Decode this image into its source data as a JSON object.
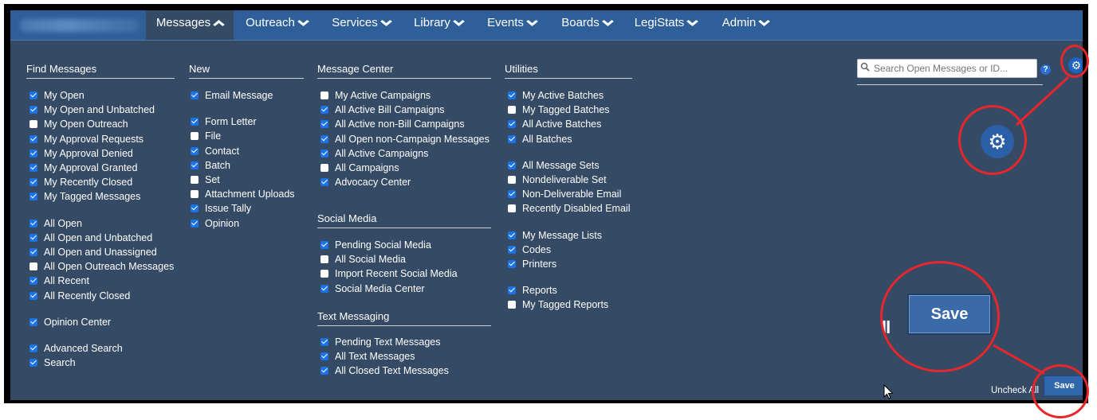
{
  "nav": {
    "items": [
      {
        "label": "Messages",
        "active": true
      },
      {
        "label": "Outreach"
      },
      {
        "label": "Services"
      },
      {
        "label": "Library"
      },
      {
        "label": "Events"
      },
      {
        "label": "Boards"
      },
      {
        "label": "LegiStats"
      },
      {
        "label": "Admin"
      }
    ],
    "active_chevron": "chevron-up-icon",
    "chevron": "chevron-down-icon"
  },
  "columns": {
    "find": {
      "title": "Find Messages",
      "items": [
        {
          "label": "My Open",
          "checked": true
        },
        {
          "label": "My Open and Unbatched",
          "checked": true
        },
        {
          "label": "My Open Outreach",
          "checked": false
        },
        {
          "label": "My Approval Requests",
          "checked": true
        },
        {
          "label": "My Approval Denied",
          "checked": true
        },
        {
          "label": "My Approval Granted",
          "checked": true
        },
        {
          "label": "My Recently Closed",
          "checked": true
        },
        {
          "label": "My Tagged Messages",
          "checked": true
        },
        {
          "label": "All Open",
          "checked": true
        },
        {
          "label": "All Open and Unbatched",
          "checked": true
        },
        {
          "label": "All Open and Unassigned",
          "checked": true
        },
        {
          "label": "All Open Outreach Messages",
          "checked": false
        },
        {
          "label": "All Recent",
          "checked": true
        },
        {
          "label": "All Recently Closed",
          "checked": true
        },
        {
          "label": "Opinion Center",
          "checked": true
        },
        {
          "label": "Advanced Search",
          "checked": true
        },
        {
          "label": "Search",
          "checked": true
        }
      ]
    },
    "new": {
      "title": "New",
      "items": [
        {
          "label": "Email Message",
          "checked": true
        },
        {
          "label": "Form Letter",
          "checked": true
        },
        {
          "label": "File",
          "checked": false
        },
        {
          "label": "Contact",
          "checked": true
        },
        {
          "label": "Batch",
          "checked": true
        },
        {
          "label": "Set",
          "checked": false
        },
        {
          "label": "Attachment Uploads",
          "checked": false
        },
        {
          "label": "Issue Tally",
          "checked": true
        },
        {
          "label": "Opinion",
          "checked": true
        }
      ]
    },
    "message_center": {
      "title": "Message Center",
      "items": [
        {
          "label": "My Active Campaigns",
          "checked": false
        },
        {
          "label": "All Active Bill Campaigns",
          "checked": true
        },
        {
          "label": "All Active non-Bill Campaigns",
          "checked": true
        },
        {
          "label": "All Open non-Campaign Messages",
          "checked": true
        },
        {
          "label": "All Active Campaigns",
          "checked": true
        },
        {
          "label": "All Campaigns",
          "checked": false
        },
        {
          "label": "Advocacy Center",
          "checked": true
        }
      ]
    },
    "social_media": {
      "title": "Social Media",
      "items": [
        {
          "label": "Pending Social Media",
          "checked": true
        },
        {
          "label": "All Social Media",
          "checked": false
        },
        {
          "label": "Import Recent Social Media",
          "checked": false
        },
        {
          "label": "Social Media Center",
          "checked": true
        }
      ]
    },
    "text_messaging": {
      "title": "Text Messaging",
      "items": [
        {
          "label": "Pending Text Messages",
          "checked": true
        },
        {
          "label": "All Text Messages",
          "checked": true
        },
        {
          "label": "All Closed Text Messages",
          "checked": true
        }
      ]
    },
    "utilities": {
      "title": "Utilities",
      "items": [
        {
          "label": "My Active Batches",
          "checked": true
        },
        {
          "label": "My Tagged Batches",
          "checked": false
        },
        {
          "label": "All Active Batches",
          "checked": true
        },
        {
          "label": "All Batches",
          "checked": true
        },
        {
          "label": "All Message Sets",
          "checked": true
        },
        {
          "label": "Nondeliverable Set",
          "checked": false
        },
        {
          "label": "Non-Deliverable Email",
          "checked": true
        },
        {
          "label": "Recently Disabled Email",
          "checked": false
        },
        {
          "label": "My Message Lists",
          "checked": true
        },
        {
          "label": "Codes",
          "checked": true
        },
        {
          "label": "Printers",
          "checked": true
        },
        {
          "label": "Reports",
          "checked": true
        },
        {
          "label": "My Tagged Reports",
          "checked": false
        }
      ]
    }
  },
  "search": {
    "placeholder": "Search Open Messages or ID...",
    "value": ""
  },
  "help_label": "?",
  "footer": {
    "uncheck_all": "Uncheck All",
    "save": "Save"
  },
  "zoom_callout": {
    "save": "Save",
    "fragment": "ll"
  },
  "colors": {
    "panel": "#354a64",
    "navbar": "#2f5f99",
    "checkbox": "#1a73e8",
    "annotation": "#e8262c"
  }
}
